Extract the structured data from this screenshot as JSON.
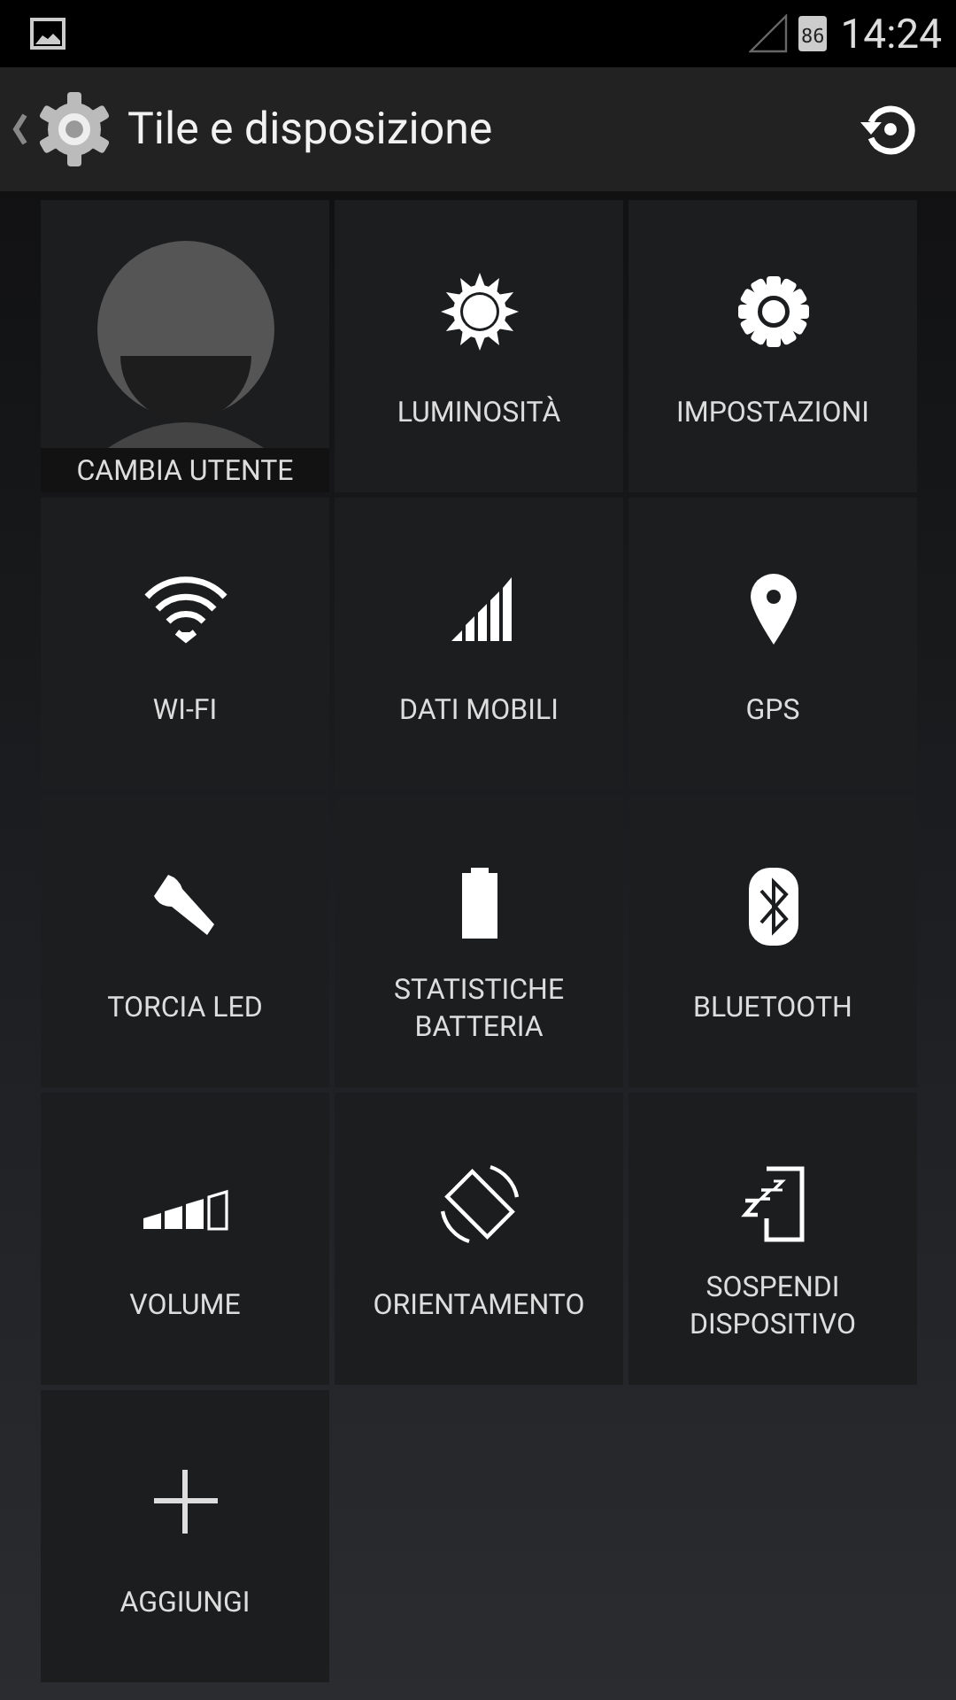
{
  "status_bar": {
    "battery": "86",
    "time": "14:24"
  },
  "action_bar": {
    "title": "Tile e disposizione"
  },
  "tiles": [
    {
      "kind": "user",
      "label": "CAMBIA UTENTE"
    },
    {
      "kind": "tile",
      "label": "LUMINOSITÀ"
    },
    {
      "kind": "tile",
      "label": "IMPOSTAZIONI"
    },
    {
      "kind": "tile",
      "label": "WI-FI"
    },
    {
      "kind": "tile",
      "label": "DATI MOBILI"
    },
    {
      "kind": "tile",
      "label": "GPS"
    },
    {
      "kind": "tile",
      "label": "TORCIA LED"
    },
    {
      "kind": "tile",
      "label": "STATISTICHE BATTERIA"
    },
    {
      "kind": "tile",
      "label": "BLUETOOTH"
    },
    {
      "kind": "tile",
      "label": "VOLUME"
    },
    {
      "kind": "tile",
      "label": "ORIENTAMENTO"
    },
    {
      "kind": "tile",
      "label": "SOSPENDI DISPOSITIVO"
    },
    {
      "kind": "add",
      "label": "AGGIUNGI"
    }
  ]
}
